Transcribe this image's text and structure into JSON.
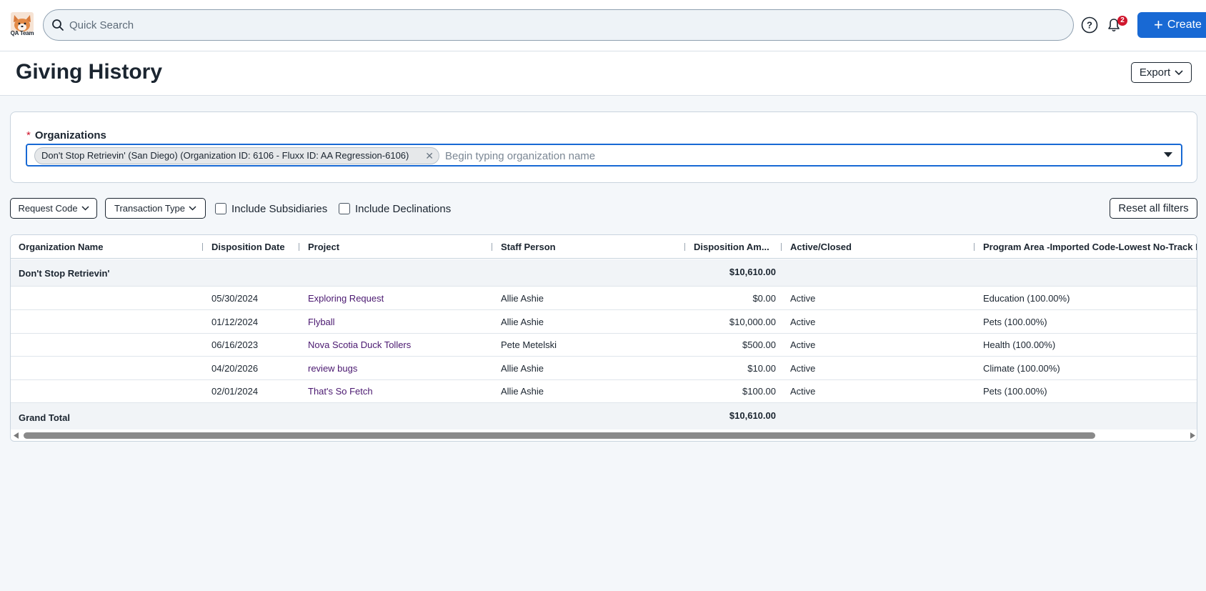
{
  "topbar": {
    "logo_text": "QA Team",
    "search_placeholder": "Quick Search",
    "notification_count": "2",
    "create_label": "Create",
    "icons": [
      "search-icon",
      "help-icon",
      "bell-icon",
      "plus-icon"
    ]
  },
  "page": {
    "title": "Giving History",
    "export_label": "Export"
  },
  "organizations": {
    "label": "Organizations",
    "required_mark": "*",
    "selected_chip": "Don't Stop Retrievin' (San Diego) (Organization ID: 6106 - Fluxx ID: AA Regression-6106)",
    "placeholder": "Begin typing organization name"
  },
  "filters": {
    "request_code": "Request Code",
    "transaction_type": "Transaction Type",
    "include_subsidiaries": "Include Subsidiaries",
    "include_declinations": "Include Declinations",
    "reset": "Reset all filters"
  },
  "grid": {
    "columns": [
      "Organization Name",
      "Disposition Date",
      "Project",
      "Staff Person",
      "Disposition Am...",
      "Active/Closed",
      "Program Area -Imported Code-Lowest No-Track I"
    ],
    "group": {
      "organization": "Don't Stop Retrievin'",
      "amount": "$10,610.00"
    },
    "rows": [
      {
        "date": "05/30/2024",
        "project": "Exploring Request",
        "staff": "Allie Ashie",
        "amount": "$0.00",
        "status": "Active",
        "program": "Education (100.00%)"
      },
      {
        "date": "01/12/2024",
        "project": "Flyball",
        "staff": "Allie Ashie",
        "amount": "$10,000.00",
        "status": "Active",
        "program": "Pets (100.00%)"
      },
      {
        "date": "06/16/2023",
        "project": "Nova Scotia Duck Tollers",
        "staff": "Pete Metelski",
        "amount": "$500.00",
        "status": "Active",
        "program": "Health (100.00%)"
      },
      {
        "date": "04/20/2026",
        "project": "review bugs",
        "staff": "Allie Ashie",
        "amount": "$10.00",
        "status": "Active",
        "program": "Climate (100.00%)"
      },
      {
        "date": "02/01/2024",
        "project": "That's So Fetch",
        "staff": "Allie Ashie",
        "amount": "$100.00",
        "status": "Active",
        "program": "Pets (100.00%)"
      }
    ],
    "total": {
      "label": "Grand Total",
      "amount": "$10,610.00"
    }
  },
  "colors": {
    "accent": "#1869d4",
    "link": "#4a1870",
    "badge": "#d0162d",
    "page_bg": "#f4f7fa"
  }
}
